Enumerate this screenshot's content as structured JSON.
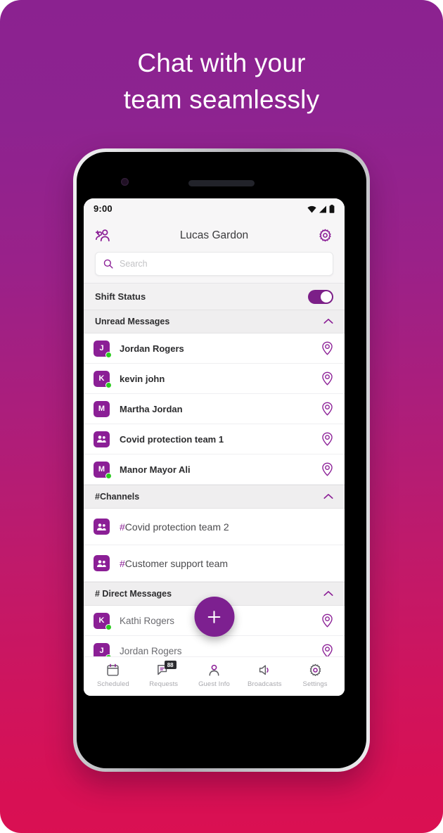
{
  "promo": {
    "title_line1": "Chat with your",
    "title_line2": "team seamlessly",
    "bg_top_color": "#8b2290",
    "bg_bottom_color": "#da1052"
  },
  "accent_color": "#8b1f96",
  "online_color": "#2bcc1f",
  "phone": {
    "statusbar": {
      "time": "9:00",
      "icons": [
        "wifi-icon",
        "cellular-signal-icon",
        "battery-icon"
      ]
    },
    "appbar": {
      "add_person_icon": "add-person-icon",
      "title": "Lucas Gardon",
      "settings_icon": "gear-icon"
    },
    "search": {
      "icon": "search-icon",
      "placeholder": "Search",
      "value": ""
    },
    "shift_status": {
      "label": "Shift Status",
      "toggle_on": true
    },
    "sections": [
      {
        "id": "unread",
        "title": "Unread Messages",
        "chevron": "chevron-up-icon",
        "expanded": true,
        "rows": [
          {
            "initial": "J",
            "label": "Jordan Rogers",
            "online": true,
            "avatar_type": "initial",
            "end_icon": "location-pin-icon"
          },
          {
            "initial": "K",
            "label": "kevin john",
            "online": true,
            "avatar_type": "initial",
            "end_icon": "location-pin-icon"
          },
          {
            "initial": "M",
            "label": "Martha Jordan",
            "online": false,
            "avatar_type": "initial",
            "end_icon": "location-pin-icon"
          },
          {
            "initial": "",
            "label": "Covid protection team 1",
            "online": false,
            "avatar_type": "group",
            "end_icon": "location-pin-icon"
          },
          {
            "initial": "M",
            "label": "Manor Mayor Ali",
            "online": true,
            "avatar_type": "initial",
            "end_icon": "location-pin-icon"
          }
        ]
      },
      {
        "id": "channels",
        "title": "#Channels",
        "chevron": "chevron-up-icon",
        "expanded": true,
        "rows": [
          {
            "initial": "",
            "label": "Covid protection team 2",
            "hash": "#",
            "online": false,
            "avatar_type": "group",
            "end_icon": ""
          },
          {
            "initial": "",
            "label": "Customer support team",
            "hash": "#",
            "online": false,
            "avatar_type": "group",
            "end_icon": ""
          }
        ]
      },
      {
        "id": "direct-messages",
        "title": "# Direct Messages",
        "chevron": "chevron-up-icon",
        "expanded": true,
        "rows": [
          {
            "initial": "K",
            "label": "Kathi Rogers",
            "online": true,
            "avatar_type": "initial",
            "end_icon": "location-pin-icon"
          },
          {
            "initial": "J",
            "label": "Jordan Rogers",
            "online": true,
            "avatar_type": "initial",
            "end_icon": "location-pin-icon"
          }
        ]
      }
    ],
    "fab": {
      "icon": "plus-icon",
      "label": "+"
    },
    "bottomnav": [
      {
        "icon": "calendar-icon",
        "label": "Scheduled",
        "badge": ""
      },
      {
        "icon": "requests-chat-icon",
        "label": "Requests",
        "badge": "88"
      },
      {
        "icon": "person-icon",
        "label": "Guest Info",
        "badge": ""
      },
      {
        "icon": "speaker-icon",
        "label": "Broadcasts",
        "badge": ""
      },
      {
        "icon": "gear-icon",
        "label": "Settings",
        "badge": ""
      }
    ]
  }
}
